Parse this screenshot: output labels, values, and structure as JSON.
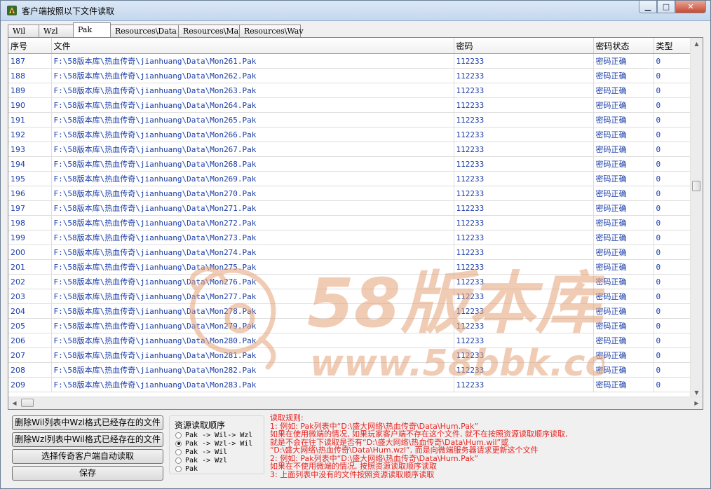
{
  "window": {
    "title": "客户端按照以下文件读取",
    "min_glyph": "▁",
    "max_glyph": "□",
    "close_glyph": "✕"
  },
  "tabs": [
    {
      "label": "Wil",
      "active": false
    },
    {
      "label": "Wzl",
      "active": false
    },
    {
      "label": "Pak",
      "active": true
    },
    {
      "label": "Resources\\Data",
      "active": false
    },
    {
      "label": "Resources\\Map",
      "active": false
    },
    {
      "label": "Resources\\Wav",
      "active": false
    }
  ],
  "grid": {
    "columns": [
      "序号",
      "文件",
      "密码",
      "密码状态",
      "类型"
    ],
    "rows": [
      {
        "no": "187",
        "file": "F:\\58版本库\\热血传奇\\jianhuang\\Data\\Mon261.Pak",
        "pw": "112233",
        "status": "密码正确",
        "type": "0"
      },
      {
        "no": "188",
        "file": "F:\\58版本库\\热血传奇\\jianhuang\\Data\\Mon262.Pak",
        "pw": "112233",
        "status": "密码正确",
        "type": "0"
      },
      {
        "no": "189",
        "file": "F:\\58版本库\\热血传奇\\jianhuang\\Data\\Mon263.Pak",
        "pw": "112233",
        "status": "密码正确",
        "type": "0"
      },
      {
        "no": "190",
        "file": "F:\\58版本库\\热血传奇\\jianhuang\\Data\\Mon264.Pak",
        "pw": "112233",
        "status": "密码正确",
        "type": "0"
      },
      {
        "no": "191",
        "file": "F:\\58版本库\\热血传奇\\jianhuang\\Data\\Mon265.Pak",
        "pw": "112233",
        "status": "密码正确",
        "type": "0"
      },
      {
        "no": "192",
        "file": "F:\\58版本库\\热血传奇\\jianhuang\\Data\\Mon266.Pak",
        "pw": "112233",
        "status": "密码正确",
        "type": "0"
      },
      {
        "no": "193",
        "file": "F:\\58版本库\\热血传奇\\jianhuang\\Data\\Mon267.Pak",
        "pw": "112233",
        "status": "密码正确",
        "type": "0"
      },
      {
        "no": "194",
        "file": "F:\\58版本库\\热血传奇\\jianhuang\\Data\\Mon268.Pak",
        "pw": "112233",
        "status": "密码正确",
        "type": "0"
      },
      {
        "no": "195",
        "file": "F:\\58版本库\\热血传奇\\jianhuang\\Data\\Mon269.Pak",
        "pw": "112233",
        "status": "密码正确",
        "type": "0"
      },
      {
        "no": "196",
        "file": "F:\\58版本库\\热血传奇\\jianhuang\\Data\\Mon270.Pak",
        "pw": "112233",
        "status": "密码正确",
        "type": "0"
      },
      {
        "no": "197",
        "file": "F:\\58版本库\\热血传奇\\jianhuang\\Data\\Mon271.Pak",
        "pw": "112233",
        "status": "密码正确",
        "type": "0"
      },
      {
        "no": "198",
        "file": "F:\\58版本库\\热血传奇\\jianhuang\\Data\\Mon272.Pak",
        "pw": "112233",
        "status": "密码正确",
        "type": "0"
      },
      {
        "no": "199",
        "file": "F:\\58版本库\\热血传奇\\jianhuang\\Data\\Mon273.Pak",
        "pw": "112233",
        "status": "密码正确",
        "type": "0"
      },
      {
        "no": "200",
        "file": "F:\\58版本库\\热血传奇\\jianhuang\\Data\\Mon274.Pak",
        "pw": "112233",
        "status": "密码正确",
        "type": "0"
      },
      {
        "no": "201",
        "file": "F:\\58版本库\\热血传奇\\jianhuang\\Data\\Mon275.Pak",
        "pw": "112233",
        "status": "密码正确",
        "type": "0"
      },
      {
        "no": "202",
        "file": "F:\\58版本库\\热血传奇\\jianhuang\\Data\\Mon276.Pak",
        "pw": "112233",
        "status": "密码正确",
        "type": "0"
      },
      {
        "no": "203",
        "file": "F:\\58版本库\\热血传奇\\jianhuang\\Data\\Mon277.Pak",
        "pw": "112233",
        "status": "密码正确",
        "type": "0"
      },
      {
        "no": "204",
        "file": "F:\\58版本库\\热血传奇\\jianhuang\\Data\\Mon278.Pak",
        "pw": "112233",
        "status": "密码正确",
        "type": "0"
      },
      {
        "no": "205",
        "file": "F:\\58版本库\\热血传奇\\jianhuang\\Data\\Mon279.Pak",
        "pw": "112233",
        "status": "密码正确",
        "type": "0"
      },
      {
        "no": "206",
        "file": "F:\\58版本库\\热血传奇\\jianhuang\\Data\\Mon280.Pak",
        "pw": "112233",
        "status": "密码正确",
        "type": "0"
      },
      {
        "no": "207",
        "file": "F:\\58版本库\\热血传奇\\jianhuang\\Data\\Mon281.Pak",
        "pw": "112233",
        "status": "密码正确",
        "type": "0"
      },
      {
        "no": "208",
        "file": "F:\\58版本库\\热血传奇\\jianhuang\\Data\\Mon282.Pak",
        "pw": "112233",
        "status": "密码正确",
        "type": "0"
      },
      {
        "no": "209",
        "file": "F:\\58版本库\\热血传奇\\jianhuang\\Data\\Mon283.Pak",
        "pw": "112233",
        "status": "密码正确",
        "type": "0"
      }
    ]
  },
  "buttons": {
    "delete_wil": "删除Wil列表中Wzl格式已经存在的文件",
    "delete_wzl": "删除Wzl列表中Wil格式已经存在的文件",
    "select_client": "选择传奇客户端自动读取",
    "save": "保存"
  },
  "resource_order": {
    "title": "资源读取顺序",
    "options": [
      {
        "label": "Pak -> Wil-> Wzl",
        "selected": false
      },
      {
        "label": "Pak -> Wzl-> Wil",
        "selected": true
      },
      {
        "label": "Pak -> Wil",
        "selected": false
      },
      {
        "label": "Pak -> Wzl",
        "selected": false
      },
      {
        "label": "Pak",
        "selected": false
      }
    ]
  },
  "rules": {
    "lines": [
      "读取规则:",
      "1: 例如: Pak列表中“D:\\盛大网络\\热血传奇\\Data\\Hum.Pak”",
      "    如果在使用微端的情况, 如果玩家客户端不存在这个文件, 就不在按照资源读取顺序读取,",
      "    就是不会在往下读取是否有“D:\\盛大网络\\热血传奇\\Data\\Hum.wil”或",
      "“D:\\盛大网络\\热血传奇\\Data\\Hum.wzl”, 而是向微端服务器请求更新这个文件",
      "2: 例如: Pak列表中“D:\\盛大网络\\热血传奇\\Data\\Hum.Pak”",
      "    如果在不使用微端的情况, 按照资源读取顺序读取",
      "3: 上面列表中没有的文件按照资源读取顺序读取"
    ]
  },
  "watermark": {
    "brand": "58版本库",
    "url": "www.58bbk.com"
  },
  "colors": {
    "cell_text": "#1c3fa8",
    "rules_text": "#e8231f",
    "watermark": "#e6a37a"
  }
}
